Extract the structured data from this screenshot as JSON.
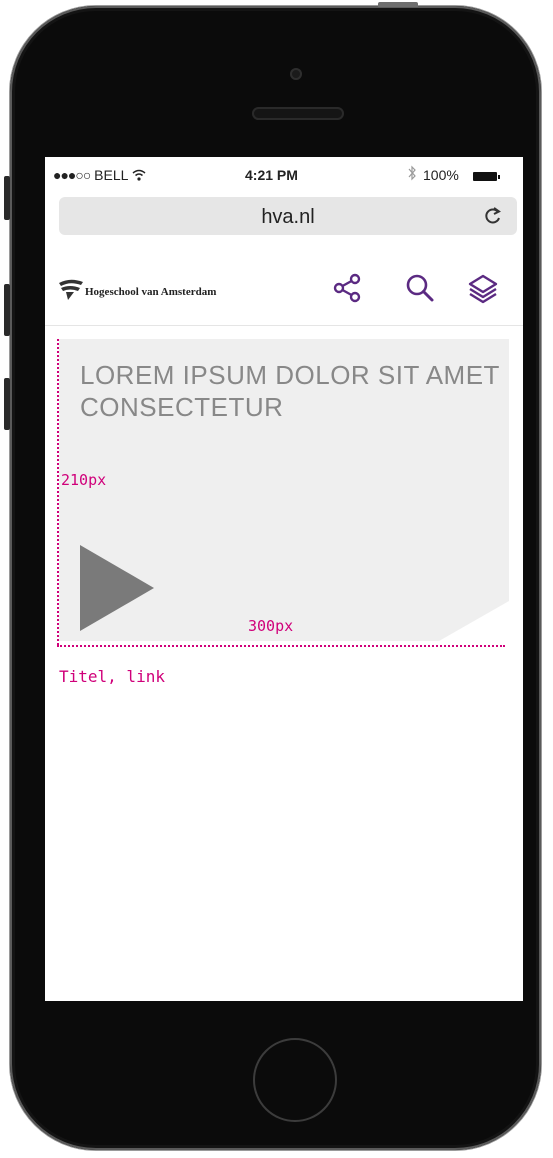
{
  "status_bar": {
    "signal": "●●●○○",
    "carrier": "BELL",
    "time": "4:21 PM",
    "battery": "100%"
  },
  "browser": {
    "url": "hva.nl"
  },
  "header": {
    "logo_text": "Hogeschool van Amsterdam",
    "accent_color": "#5b2a82"
  },
  "card": {
    "title": "LOREM IPSUM DOLOR SIT AMET CONSECTETUR"
  },
  "annotations": {
    "height_label": "210px",
    "width_label": "300px",
    "caption": "Titel, link",
    "color": "#d0007a"
  },
  "icons": [
    "wifi-icon",
    "bluetooth-icon",
    "battery-icon",
    "reload-icon",
    "hva-logo-icon",
    "share-icon",
    "search-icon",
    "layers-icon",
    "play-icon"
  ]
}
